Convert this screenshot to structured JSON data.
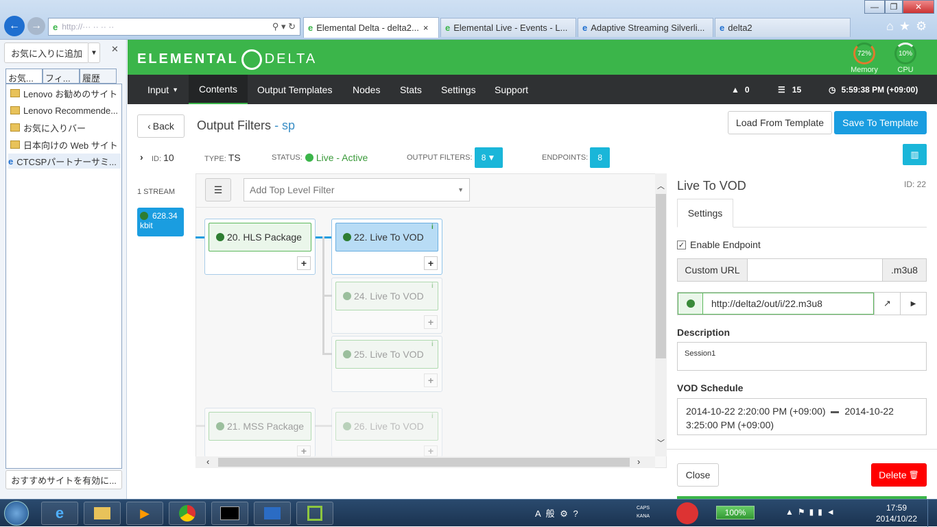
{
  "browser": {
    "address": "http://··· ·· ·· ··",
    "tabs": [
      "Elemental Delta - delta2...",
      "Elemental Live - Events - L...",
      "Adaptive Streaming Silverli...",
      "delta2"
    ],
    "close": "×"
  },
  "favorites": {
    "add_button": "お気に入りに追加",
    "tabs": [
      "お気...",
      "フィ...",
      "履歴"
    ],
    "items": [
      "Lenovo お勧めのサイト",
      "Lenovo Recommende...",
      "お気に入りバー",
      "日本向けの Web サイト",
      "CTCSPパートナーサミ..."
    ],
    "bottom_button": "おすすめサイトを有効に..."
  },
  "app": {
    "logo_left": "ELEMENTAL",
    "logo_right": "DELTA",
    "memory": {
      "value": "72%",
      "label": "Memory",
      "level": 0.72
    },
    "cpu": {
      "value": "10%",
      "label": "CPU",
      "level": 0.1
    },
    "nav": [
      "Input",
      "Contents",
      "Output Templates",
      "Nodes",
      "Stats",
      "Settings",
      "Support"
    ],
    "alerts": "0",
    "messages": "15",
    "time": "5:59:38 PM (+09:00)"
  },
  "page": {
    "back": "Back",
    "title": "Output Filters",
    "title_suffix": "- sp",
    "load_template": "Load From Template",
    "save_template": "Save To Template",
    "id_label": "ID:",
    "id": "10",
    "type_label": "TYPE:",
    "type": "TS",
    "status_label": "STATUS:",
    "status": "Live - Active",
    "filters_label": "OUTPUT FILTERS:",
    "filters_count": "8",
    "endpoints_label": "ENDPOINTS:",
    "endpoints_count": "8"
  },
  "stream": {
    "count": "1 STREAM",
    "rate": "628.34",
    "unit": "kbit"
  },
  "filter_select": {
    "placeholder": "Add Top Level Filter"
  },
  "nodes": {
    "hls": "20. HLS Package",
    "n22": "22. Live To VOD",
    "n24": "24. Live To VOD",
    "n25": "25. Live To VOD",
    "mss": "21. MSS Package",
    "n26": "26. Live To VOD",
    "info": "i",
    "plus": "+"
  },
  "detail": {
    "title": "Live To VOD",
    "id": "ID: 22",
    "tab": "Settings",
    "enable": "Enable Endpoint",
    "custom_url": "Custom URL",
    "ext": ".m3u8",
    "url": "http://delta2/out/i/22.m3u8",
    "desc_label": "Description",
    "desc": "Session1",
    "vod_label": "VOD Schedule",
    "vod_start": "2014-10-22 2:20:00 PM (+09:00)",
    "vod_end": "2014-10-22 3:25:00 PM (+09:00)",
    "close": "Close",
    "delete": "Delete"
  },
  "taskbar": {
    "battery": "100%",
    "time": "17:59",
    "date": "2014/10/22",
    "ime": "A 般",
    "caps": "CAPS",
    "kana": "KANA"
  }
}
